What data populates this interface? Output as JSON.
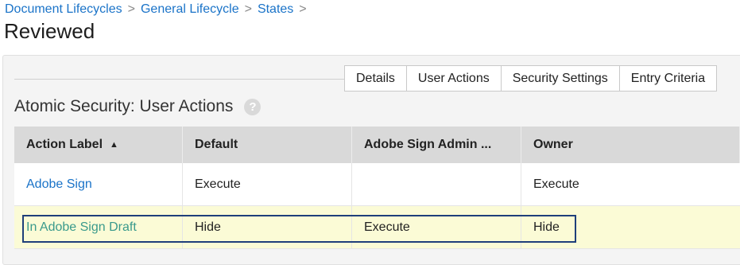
{
  "breadcrumb": {
    "items": [
      "Document Lifecycles",
      "General Lifecycle",
      "States"
    ],
    "separator": ">"
  },
  "page_title": "Reviewed",
  "tabs": [
    "Details",
    "User Actions",
    "Security Settings",
    "Entry Criteria"
  ],
  "section": {
    "title": "Atomic Security: User Actions",
    "help_icon": "question-circle-icon",
    "help_glyph": "?"
  },
  "table": {
    "columns": [
      "Action Label",
      "Default",
      "Adobe Sign Admin ...",
      "Owner"
    ],
    "sort_indicator": "▲",
    "rows": [
      [
        "Adobe Sign",
        "Execute",
        "",
        "Execute"
      ],
      [
        "In Adobe Sign Draft",
        "Hide",
        "Execute",
        "Hide"
      ]
    ]
  },
  "colors": {
    "link": "#1a73c8",
    "highlight_row": "#fbfbd6",
    "highlight_border": "#1f3f7a"
  }
}
